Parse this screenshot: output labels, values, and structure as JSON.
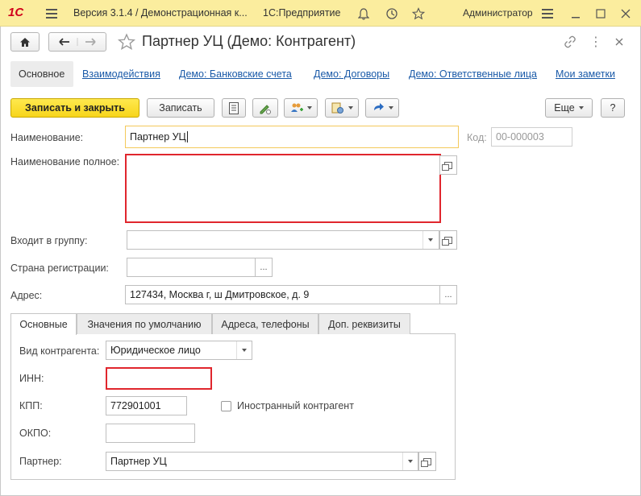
{
  "titlebar": {
    "logo": "1С",
    "app_title": "Версия 3.1.4 / Демонстрационная к...",
    "platform": "1С:Предприятие",
    "user": "Администратор"
  },
  "form": {
    "title": "Партнер УЦ (Демо: Контрагент)"
  },
  "nav": {
    "main": "Основное",
    "links": [
      "Взаимодействия",
      "Демо: Банковские счета",
      "Демо: Договоры",
      "Демо: Ответственные лица",
      "Мои заметки"
    ]
  },
  "toolbar": {
    "save_close": "Записать и закрыть",
    "save": "Записать",
    "more": "Еще",
    "help": "?"
  },
  "fields": {
    "name_label": "Наименование:",
    "name_value": "Партнер УЦ",
    "code_label": "Код:",
    "code_value": "00-000003",
    "full_name_label": "Наименование полное:",
    "full_name_value": "",
    "group_label": "Входит в группу:",
    "group_value": "",
    "country_label": "Страна регистрации:",
    "country_value": "",
    "address_label": "Адрес:",
    "address_value": "127434, Москва г, ш Дмитровское, д. 9"
  },
  "tabs": [
    "Основные",
    "Значения по умолчанию",
    "Адреса, телефоны",
    "Доп. реквизиты"
  ],
  "main_tab": {
    "kind_label": "Вид контрагента:",
    "kind_value": "Юридическое лицо",
    "inn_label": "ИНН:",
    "inn_value": "",
    "kpp_label": "КПП:",
    "kpp_value": "772901001",
    "foreign_label": "Иностранный контрагент",
    "foreign_checked": false,
    "okpo_label": "ОКПО:",
    "okpo_value": "",
    "partner_label": "Партнер:",
    "partner_value": "Партнер УЦ"
  },
  "colors": {
    "titlebar": "#fbed9e",
    "primary_button": "#f7d51b",
    "link": "#1a5aa8",
    "error_border": "#e0262d",
    "focus_border": "#f4c95b"
  }
}
